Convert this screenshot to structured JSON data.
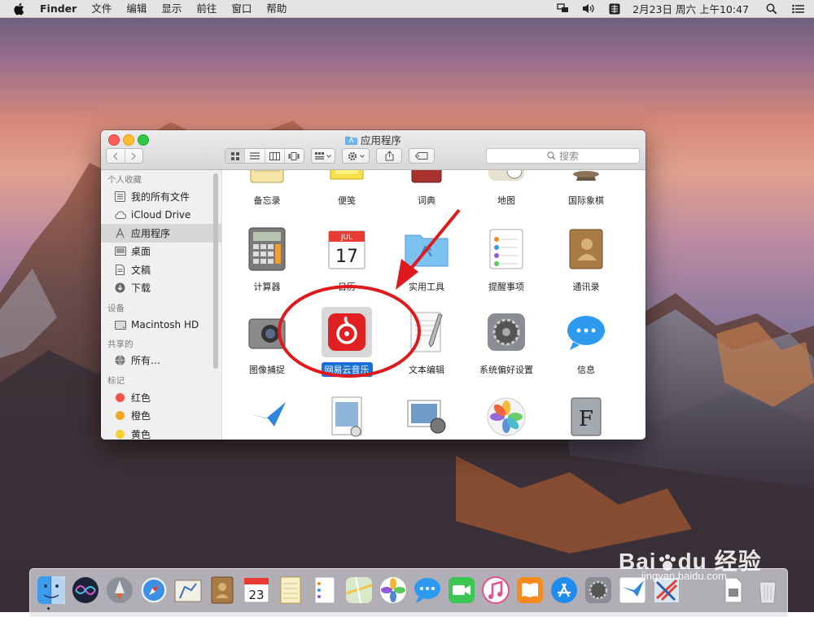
{
  "menubar": {
    "app_name": "Finder",
    "menus": [
      "文件",
      "编辑",
      "显示",
      "前往",
      "窗口",
      "帮助"
    ],
    "clock": "2月23日 周六 上午10:47",
    "status_icons": [
      "display-mirroring-icon",
      "volume-icon",
      "input-method-icon",
      "search-icon",
      "list-icon"
    ]
  },
  "window": {
    "title": "应用程序",
    "search_placeholder": "搜索",
    "toolbar": {
      "back": "back-icon",
      "forward": "forward-icon",
      "view_modes": [
        "icon-view",
        "list-view",
        "column-view",
        "cover-flow-view"
      ],
      "active_view": "icon-view",
      "arrange": "arrange-icon",
      "action": "gear-icon",
      "share": "share-icon",
      "tags": "tag-icon"
    }
  },
  "sidebar": {
    "favorites_header": "个人收藏",
    "favorites": [
      "我的所有文件",
      "iCloud Drive",
      "应用程序",
      "桌面",
      "文稿",
      "下载"
    ],
    "selected": "应用程序",
    "devices_header": "设备",
    "devices": [
      "Macintosh HD"
    ],
    "shared_header": "共享的",
    "shared": [
      "所有…"
    ],
    "tags_header": "标记",
    "tags": [
      {
        "label": "红色",
        "color": "#f2514a"
      },
      {
        "label": "橙色",
        "color": "#f5a623"
      },
      {
        "label": "黄色",
        "color": "#f5d033"
      }
    ]
  },
  "apps": {
    "row1": [
      "备忘录",
      "便笺",
      "词典",
      "地图",
      "国际象棋"
    ],
    "row2": [
      "计算器",
      "日历",
      "实用工具",
      "提醒事项",
      "通讯录"
    ],
    "row3": [
      "图像捕捉",
      "网易云音乐",
      "文本编辑",
      "系统偏好设置",
      "信息"
    ],
    "selected": "网易云音乐",
    "calendar_month": "JUL",
    "calendar_day": "17",
    "row4_icons": [
      "mail-app-icon",
      "preview-app-icon",
      "photo-booth-icon",
      "photos-app-icon",
      "font-book-icon"
    ]
  },
  "dock": {
    "calendar_day": "23",
    "icons": [
      "finder-icon",
      "siri-icon",
      "launchpad-icon",
      "safari-icon",
      "mail-app-icon",
      "contacts-icon",
      "calendar-icon",
      "notes-icon",
      "reminders-icon",
      "maps-icon",
      "photos-icon",
      "messages-icon",
      "facetime-icon",
      "itunes-icon",
      "ibooks-icon",
      "app-store-icon",
      "system-preferences-icon",
      "mail-bird-icon",
      "sketch-icon",
      "document-icon",
      "trash-icon"
    ]
  },
  "watermark": {
    "brand": "Bai",
    "brand2": "du",
    "brand_cn": "经验",
    "url": "jingyan.baidu.com"
  },
  "colors": {
    "annotation_red": "#e0191c",
    "selection_blue": "#1a6fd9",
    "netease_red": "#e02021"
  }
}
